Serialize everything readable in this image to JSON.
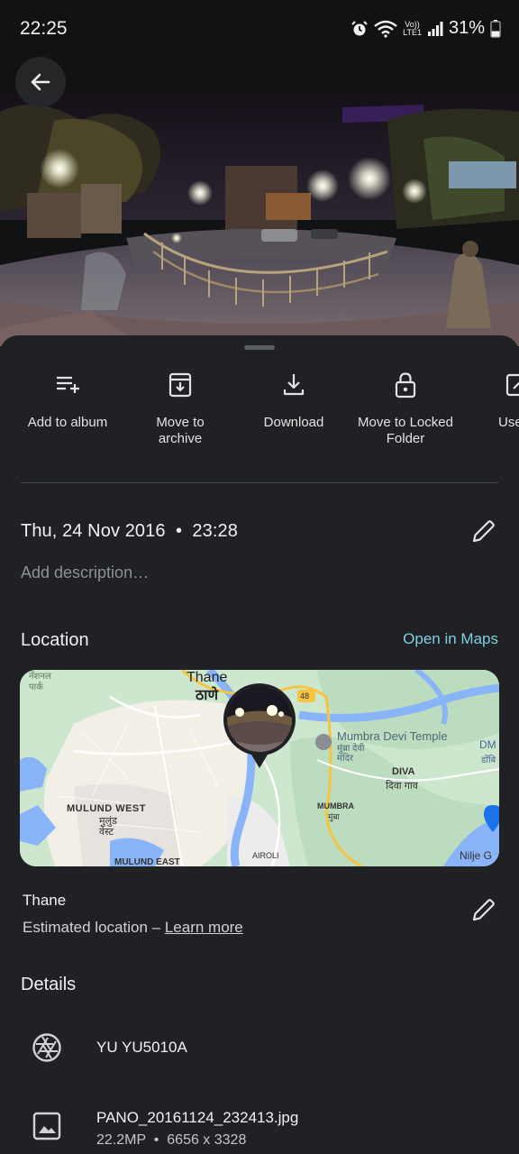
{
  "status_bar": {
    "time": "22:25",
    "battery": "31%",
    "network_top": "Vo))",
    "network_bottom": "LTE1",
    "icons": [
      "alarm-icon",
      "wifi-icon",
      "signal-icon",
      "battery-icon"
    ]
  },
  "photo": {
    "back_icon": "arrow-back-icon"
  },
  "actions": [
    {
      "label": "Add to album",
      "icon": "playlist-add-icon"
    },
    {
      "label": "Move to archive",
      "icon": "archive-icon"
    },
    {
      "label": "Download",
      "icon": "download-icon"
    },
    {
      "label": "Move to Locked Folder",
      "icon": "lock-icon"
    },
    {
      "label": "Use",
      "icon": "open-external-icon"
    }
  ],
  "info": {
    "date": "Thu, 24 Nov 2016",
    "time": "23:28",
    "description_placeholder": "Add description…"
  },
  "location": {
    "title": "Location",
    "open_in_maps": "Open in Maps",
    "place": "Thane",
    "estimated_prefix": "Estimated location –",
    "learn_more": "Learn more",
    "map_labels": {
      "thane_en": "Thane",
      "thane_mr": "ठाणे",
      "park": "नॅशनल पार्क",
      "road_no": "48",
      "temple_en": "Mumbra Devi Temple",
      "temple_mr": "मुंब्रा देवी मंदिर",
      "diva_en": "DIVA",
      "diva_mr": "दिवा गाव",
      "mulund_en": "MULUND WEST",
      "mulund_mr": "मुलुंड वेस्ट",
      "mumbra_en": "MUMBRA",
      "mumbra_mr": "मुंबा",
      "airoli": "AIROLI",
      "mulund_east": "MULUND EAST",
      "nilje": "Nilje G",
      "dm": "DM",
      "dm_mr": "डोंबि"
    }
  },
  "details": {
    "title": "Details",
    "camera": "YU YU5010A",
    "file_name": "PANO_20161124_232413.jpg",
    "megapixels": "22.2MP",
    "resolution": "6656 x 3328"
  }
}
